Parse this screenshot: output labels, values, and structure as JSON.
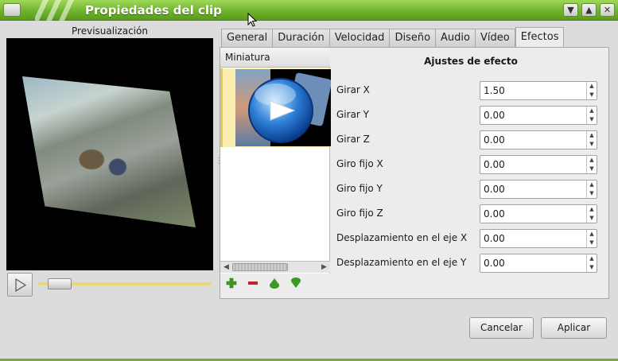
{
  "window": {
    "title": "Propiedades del clip",
    "controls": [
      "minimize",
      "maximize",
      "close"
    ]
  },
  "preview": {
    "label": "Previsualización",
    "play_icon": "play-icon"
  },
  "tabs": [
    {
      "label": "General"
    },
    {
      "label": "Duración"
    },
    {
      "label": "Velocidad"
    },
    {
      "label": "Diseño"
    },
    {
      "label": "Audio"
    },
    {
      "label": "Vídeo"
    },
    {
      "label": "Efectos",
      "active": true
    }
  ],
  "effects_list": {
    "header": "Miniatura",
    "tools": [
      "add-icon",
      "remove-icon",
      "move-up-icon",
      "move-down-icon"
    ]
  },
  "effect_settings": {
    "title": "Ajustes de efecto",
    "fields": [
      {
        "label": "Girar X",
        "value": "1.50"
      },
      {
        "label": "Girar Y",
        "value": "0.00"
      },
      {
        "label": "Girar Z",
        "value": "0.00"
      },
      {
        "label": "Giro fijo X",
        "value": "0.00"
      },
      {
        "label": "Giro fijo Y",
        "value": "0.00"
      },
      {
        "label": "Giro fijo Z",
        "value": "0.00"
      },
      {
        "label": "Desplazamiento en el eje X",
        "value": "0.00"
      },
      {
        "label": "Desplazamiento en el eje Y",
        "value": "0.00"
      }
    ]
  },
  "buttons": {
    "cancel": "Cancelar",
    "apply": "Aplicar"
  },
  "colors": {
    "titlebar": "#6fb32c",
    "selected_row": "#fbeeb1",
    "slider_track": "#e9d873",
    "add": "#3c9a22",
    "remove": "#c8202a"
  }
}
